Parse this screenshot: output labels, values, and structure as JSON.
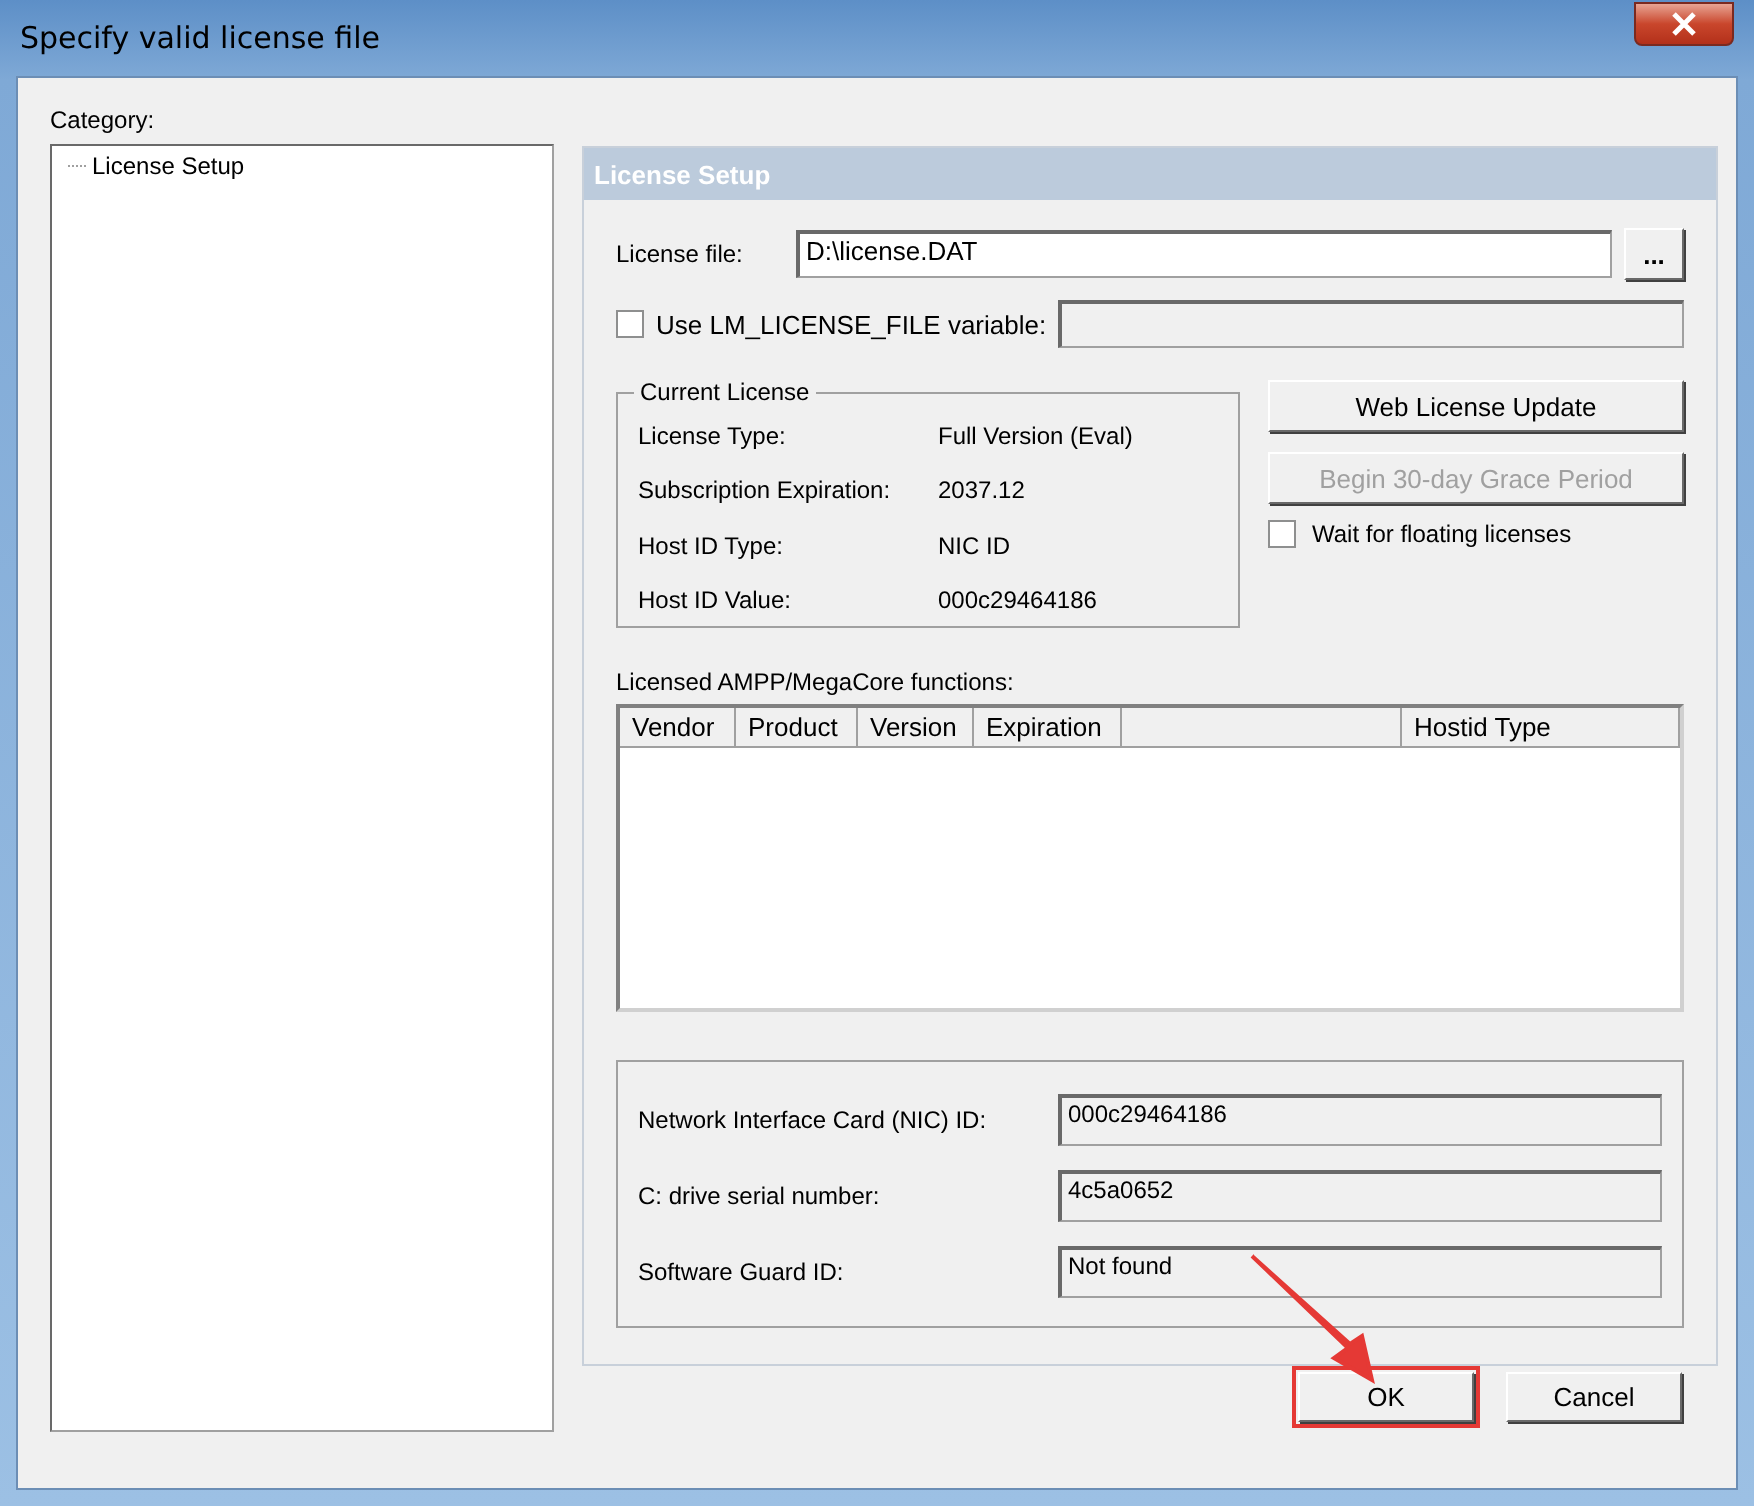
{
  "window": {
    "title": "Specify valid license file"
  },
  "category": {
    "label": "Category:",
    "items": [
      {
        "label": "License Setup",
        "selected": false
      }
    ]
  },
  "panel": {
    "title": "License Setup",
    "license_file": {
      "label": "License file:",
      "value": "D:\\license.DAT",
      "browse": "..."
    },
    "use_env": {
      "label": "Use LM_LICENSE_FILE variable:",
      "checked": false
    },
    "current_license": {
      "title": "Current License",
      "rows": [
        {
          "label": "License Type:",
          "value": "Full Version (Eval)"
        },
        {
          "label": "Subscription Expiration:",
          "value": "2037.12"
        },
        {
          "label": "Host ID Type:",
          "value": "NIC ID"
        },
        {
          "label": "Host ID Value:",
          "value": "000c29464186"
        }
      ]
    },
    "actions": [
      {
        "label": "Web License Update",
        "disabled": false
      },
      {
        "label": "Begin 30-day Grace Period",
        "disabled": true
      }
    ],
    "wait_floating": {
      "label": "Wait for floating licenses",
      "checked": false
    },
    "functions": {
      "label": "Licensed AMPP/MegaCore functions:",
      "columns": [
        "Vendor",
        "Product",
        "Version",
        "Expiration",
        "",
        "Hostid Type"
      ]
    },
    "host_ids": [
      {
        "label": "Network Interface Card (NIC) ID:",
        "value": "000c29464186"
      },
      {
        "label": "C: drive serial number:",
        "value": "4c5a0652"
      },
      {
        "label": "Software Guard ID:",
        "value": "Not found"
      }
    ]
  },
  "buttons": [
    {
      "label": "OK",
      "highlighted": true
    },
    {
      "label": "Cancel",
      "highlighted": false
    }
  ]
}
